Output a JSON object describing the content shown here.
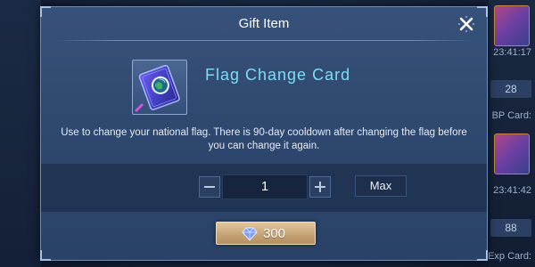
{
  "background": {
    "right_panel": {
      "time_1": "23:41:17",
      "count_1": "28",
      "label_1": "BP Card:",
      "time_2": "23:41:42",
      "count_2": "88",
      "label_2": "Exp Card:"
    }
  },
  "dialog": {
    "title": "Gift Item",
    "close_icon": "close-icon",
    "item": {
      "name": "Flag Change Card",
      "icon": "flag-card-icon",
      "description": "Use to change your national flag. There is 90-day cooldown after changing the flag before you can change it again."
    },
    "quantity": {
      "value": "1",
      "max_label": "Max"
    },
    "purchase": {
      "price": "300",
      "currency_icon": "diamond-icon"
    }
  },
  "colors": {
    "item_name": "#7fdcf3",
    "panel": "#33507a",
    "button_gold": "#c7a477"
  }
}
